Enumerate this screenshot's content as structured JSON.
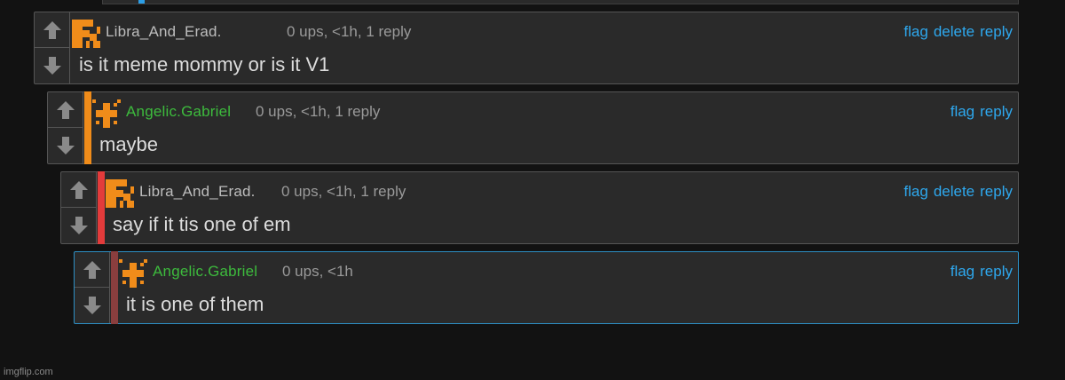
{
  "colors": {
    "background": "#121212",
    "panel": "#2a2a2a",
    "link": "#2ea8ee",
    "green_user": "#3dbb3d",
    "bar_orange": "#f08c1a",
    "bar_red": "#e33b3b",
    "bar_brown": "#8a3e3e",
    "focus_border": "#2d8fc4"
  },
  "comments": [
    {
      "username": "Libra_And_Erad.",
      "user_color": "gray",
      "meta": "0 ups, <1h, 1 reply",
      "text": "is it meme mommy or is it V1",
      "actions": {
        "flag": "flag",
        "delete": "delete",
        "reply": "reply"
      },
      "avatar_icon": "orange-pixel-avatar-icon"
    },
    {
      "username": "Angelic.Gabriel",
      "user_color": "green",
      "meta": "0 ups, <1h, 1 reply",
      "text": "maybe",
      "actions": {
        "flag": "flag",
        "reply": "reply"
      },
      "avatar_icon": "orange-pixel-cross-avatar-icon"
    },
    {
      "username": "Libra_And_Erad.",
      "user_color": "gray",
      "meta": "0 ups, <1h, 1 reply",
      "text": "say if it tis one of em",
      "actions": {
        "flag": "flag",
        "delete": "delete",
        "reply": "reply"
      },
      "avatar_icon": "orange-pixel-avatar-icon"
    },
    {
      "username": "Angelic.Gabriel",
      "user_color": "green",
      "meta": "0 ups, <1h",
      "text": "it is one of them",
      "actions": {
        "flag": "flag",
        "reply": "reply"
      },
      "avatar_icon": "orange-pixel-cross-avatar-icon"
    }
  ],
  "icons": {
    "upvote": "arrow-up-icon",
    "downvote": "arrow-down-icon"
  },
  "watermark": "imgflip.com"
}
